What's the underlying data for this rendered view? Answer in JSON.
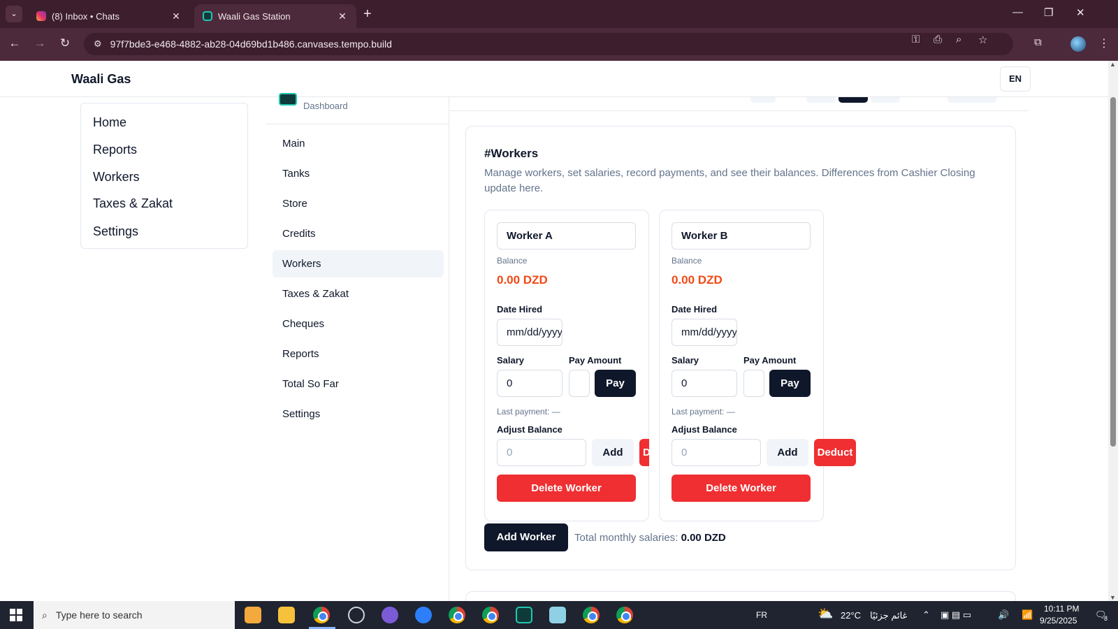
{
  "browser": {
    "tabs": [
      {
        "title": "(8) Inbox • Chats",
        "active": false
      },
      {
        "title": "Waali Gas Station",
        "active": true
      }
    ],
    "url": "97f7bde3-e468-4882-ab28-04d69bd1b486.canvases.tempo.build"
  },
  "app": {
    "brand": "Waali Gas",
    "language": "EN"
  },
  "left_nav": {
    "items": [
      "Home",
      "Reports",
      "Workers",
      "Taxes & Zakat",
      "Settings"
    ]
  },
  "sidebar": {
    "dashboard_label": "Dashboard",
    "items": [
      "Main",
      "Tanks",
      "Store",
      "Credits",
      "Workers",
      "Taxes & Zakat",
      "Cheques",
      "Reports",
      "Total So Far",
      "Settings"
    ],
    "active": "Workers"
  },
  "workers_section": {
    "title": "#Workers",
    "description": "Manage workers, set salaries, record payments, and see their balances. Differences from Cashier Closing update here.",
    "labels": {
      "balance": "Balance",
      "date_hired": "Date Hired",
      "salary": "Salary",
      "pay_amount": "Pay Amount",
      "pay": "Pay",
      "last_payment": "Last payment: —",
      "adjust_balance": "Adjust Balance",
      "add": "Add",
      "deduct": "Deduct",
      "delete_worker": "Delete Worker"
    },
    "workers": [
      {
        "name": "Worker A",
        "balance": "0.00 DZD",
        "date_placeholder": "mm/dd/yyyy",
        "salary": "0",
        "pay_amount": "",
        "adjust_placeholder": "0"
      },
      {
        "name": "Worker B",
        "balance": "0.00 DZD",
        "date_placeholder": "mm/dd/yyyy",
        "salary": "0",
        "pay_amount": "",
        "adjust_placeholder": "0"
      }
    ],
    "add_worker": "Add Worker",
    "total_label": "Total monthly salaries:",
    "total_value": "0.00 DZD"
  },
  "taskbar": {
    "search_placeholder": "Type here to search",
    "language": "FR",
    "weather": "22°C",
    "weather_text": "غائم جزئيًا",
    "time": "10:11 PM",
    "date": "9/25/2025",
    "notification_count": "8"
  },
  "colors": {
    "primary": "#0f172a",
    "danger": "#ef2f31",
    "balance": "#f04a16",
    "chrome": "#4d2a3b"
  }
}
